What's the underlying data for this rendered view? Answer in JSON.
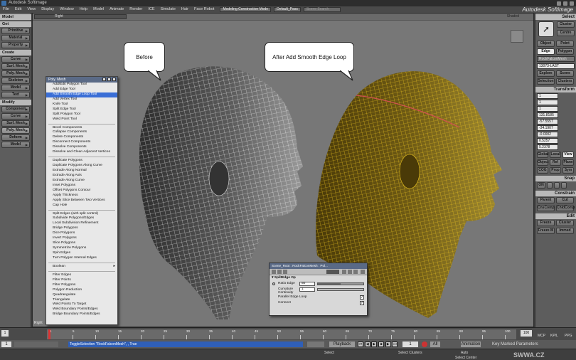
{
  "window": {
    "title": "Autodesk Softimage",
    "brand": "Autodesk Softimage"
  },
  "menubar": {
    "items": [
      "File",
      "Edit",
      "View",
      "Display",
      "Window",
      "Help",
      "Model",
      "Animate",
      "Render",
      "ICE",
      "Simulate",
      "Hair",
      "Face Robot"
    ],
    "mode_value": "Modeling Construction Mode",
    "pass_value": "Default_Pass",
    "search_placeholder": "Scene Search"
  },
  "left_panel": {
    "module": "Model",
    "sections": [
      {
        "title": "Get",
        "buttons": [
          "Primitive",
          "Material",
          "Property"
        ]
      },
      {
        "title": "Create",
        "buttons": [
          "Curve",
          "Surf. Mesh",
          "Poly. Mesh",
          "Skeleton",
          "Model",
          "Text"
        ]
      },
      {
        "title": "Modify",
        "buttons": [
          "Component",
          "Curve",
          "Surf. Mesh",
          "Poly. Mesh",
          "Deform",
          "Model"
        ]
      }
    ]
  },
  "viewport": {
    "camera": "Right",
    "display_mode": "Shaded",
    "footer_label": "Right",
    "callout_before": "Before",
    "callout_after": "After Add Smooth Edge Loop"
  },
  "poly_menu": {
    "title": "Poly. Mesh",
    "selected_index": 4,
    "groups": [
      [
        "Add/Edit Polygon Tool",
        "Add Edge Tool",
        "Add Smooth Edge Loop Tool",
        "Add Vertex Tool",
        "Knife Tool",
        "Split Edge Tool",
        "Split Polygon Tool",
        "Weld Point Tool"
      ],
      [
        "Bevel Components",
        "Collapse Components",
        "Delete Components",
        "Disconnect Components",
        "Dissolve Components",
        "Dissolve and Clean Adjacent Vertices"
      ],
      [
        "Duplicate Polygons",
        "Duplicate Polygons Along Curve",
        "Extrude Along Normal",
        "Extrude Along Axis",
        "Extrude Along Curve",
        "Inset Polygons",
        "Offset Polygons Contour",
        "Apply Thickness",
        "Apply Slice Between Two Vertices",
        "Cap Hole"
      ],
      [
        "Split Edges (with split control)",
        "Subdivide Polygons/Edges",
        "Local Subdivision Refinement",
        "Bridge Polygons",
        "Dice Polygons",
        "Invert Polygons",
        "Slice Polygons",
        "Symmetrize Polygons",
        "Spin Edges",
        "Turn Polygon Internal Edges"
      ],
      [
        "Boolean"
      ],
      [
        "Filter Edges",
        "Filter Points",
        "Filter Polygons",
        "Polygon Reduction",
        "Quadrangulate",
        "Triangulate",
        "Weld Points To Target",
        "Weld Boundary Points/Edges",
        "Bridge Boundary Points/Edges"
      ]
    ],
    "selected_label": "Add Smooth Edge Loop Tool"
  },
  "property_editor": {
    "title": "Scene_Root : RockFalconMesh : Pol...",
    "section": "SplitEdge Op",
    "ratio_label": "Ratio Edge",
    "ratio_value": "50",
    "ratio_fraction": 0.5,
    "curvature_label": "Curvature Continuity",
    "curvature_value": "1",
    "parallel_label": "Parallel Edge Loop",
    "connect_label": "Connect"
  },
  "right_panel": {
    "select_title": "Select",
    "buttons_top": [
      "Cluster",
      "Centre"
    ],
    "object_btn": "Object",
    "point_btn": "Point",
    "edge_btn": "Edge",
    "polygon_btn": "Polygon",
    "mesh_name": "RockFalconMesh",
    "count_value": "13073-LAST",
    "explore": "Explore",
    "scene": "Scene",
    "selection": "Selection",
    "clusters": "Clusters",
    "transform_title": "Transform",
    "fields": [
      "1",
      "1",
      "1",
      "131.8185",
      "-57.5557",
      "-34.1907",
      "-0.0002",
      "0.5257",
      "5.2378"
    ],
    "global": "Global",
    "local": "Local",
    "view": "View",
    "object2": "Object",
    "ref": "Ref",
    "plane": "Plane",
    "cog": "COG",
    "prop": "Prop",
    "sym": "Sym",
    "snap_title": "Snap",
    "on": "ON",
    "constrain_title": "Constrain",
    "parent": "Parent",
    "cut": "Cut",
    "cnscomp": "CnsComp",
    "chldcomp": "ChldComp",
    "edit_title": "Edit",
    "freeze": "Freeze",
    "cluster2": "Cluster",
    "freezem": "Freeze M",
    "immed": "Immed"
  },
  "timeline": {
    "start": "1",
    "ticks": [
      "1",
      "5",
      "10",
      "15",
      "20",
      "25",
      "30",
      "35",
      "40",
      "45",
      "50",
      "55",
      "60",
      "65",
      "70",
      "75",
      "80",
      "85",
      "90",
      "95",
      "100"
    ],
    "end": "100",
    "mcp": "MCP",
    "kpl": "KP/L",
    "ppg": "PPG"
  },
  "playback": {
    "frame": "1",
    "playback": "Playback",
    "current": "1",
    "all": "All",
    "animation": "Animation",
    "auto": "Auto",
    "keymark": "Key Marked Parameters"
  },
  "status": {
    "command": "ToggleSelection \"RockFalconMesh\", , True",
    "select": "Select",
    "select_clusters": "Select Clusters",
    "center": "Select Center",
    "watermark": "SWWA.CZ"
  },
  "colors": {
    "accent": "#3a6ed6",
    "wire_after": "#e8c21e",
    "panel": "#5d5d5d"
  }
}
